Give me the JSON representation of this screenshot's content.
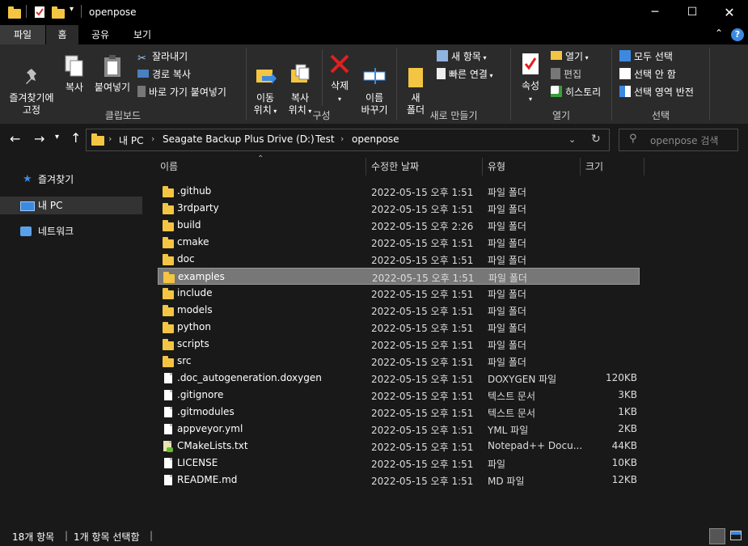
{
  "window": {
    "title": "openpose",
    "minimize_icon": "minimize-icon",
    "maximize_icon": "maximize-icon",
    "close_icon": "close-icon"
  },
  "ribbon_tabs": [
    "파일",
    "홈",
    "공유",
    "보기"
  ],
  "ribbon": {
    "clipboard": {
      "group_label": "클립보드",
      "pin": "즐겨찾기에\n고정",
      "copy": "복사",
      "paste": "붙여넣기",
      "cut": "잘라내기",
      "copy_path": "경로 복사",
      "paste_shortcut": "바로 가기 붙여넣기"
    },
    "organize": {
      "group_label": "구성",
      "move_to": "이동\n위치",
      "copy_to": "복사\n위치",
      "delete": "삭제",
      "rename": "이름\n바꾸기"
    },
    "new": {
      "group_label": "새로 만들기",
      "new_folder": "새\n폴더",
      "new_item": "새 항목",
      "easy_access": "빠른 연결"
    },
    "open": {
      "group_label": "열기",
      "properties": "속성",
      "open": "열기",
      "edit": "편집",
      "history": "히스토리"
    },
    "select": {
      "group_label": "선택",
      "select_all": "모두 선택",
      "select_none": "선택 안 함",
      "invert": "선택 영역 반전"
    }
  },
  "address": {
    "crumbs": [
      "내 PC",
      "Seagate Backup Plus Drive (D:)",
      "Test",
      "openpose"
    ],
    "search_placeholder": "openpose 검색"
  },
  "nav_pane": {
    "items": [
      {
        "label": "즐겨찾기",
        "icon": "star-icon"
      },
      {
        "label": "내 PC",
        "icon": "computer-icon"
      },
      {
        "label": "네트워크",
        "icon": "network-icon"
      }
    ]
  },
  "file_list": {
    "columns": [
      "이름",
      "수정한 날짜",
      "유형",
      "크기"
    ],
    "rows": [
      {
        "name": ".github",
        "date": "2022-05-15 오후 1:51",
        "type": "파일 폴더",
        "size": "",
        "kind": "folder"
      },
      {
        "name": "3rdparty",
        "date": "2022-05-15 오후 1:51",
        "type": "파일 폴더",
        "size": "",
        "kind": "folder"
      },
      {
        "name": "build",
        "date": "2022-05-15 오후 2:26",
        "type": "파일 폴더",
        "size": "",
        "kind": "folder"
      },
      {
        "name": "cmake",
        "date": "2022-05-15 오후 1:51",
        "type": "파일 폴더",
        "size": "",
        "kind": "folder"
      },
      {
        "name": "doc",
        "date": "2022-05-15 오후 1:51",
        "type": "파일 폴더",
        "size": "",
        "kind": "folder"
      },
      {
        "name": "examples",
        "date": "2022-05-15 오후 1:51",
        "type": "파일 폴더",
        "size": "",
        "kind": "folder",
        "selected": true
      },
      {
        "name": "include",
        "date": "2022-05-15 오후 1:51",
        "type": "파일 폴더",
        "size": "",
        "kind": "folder"
      },
      {
        "name": "models",
        "date": "2022-05-15 오후 1:51",
        "type": "파일 폴더",
        "size": "",
        "kind": "folder"
      },
      {
        "name": "python",
        "date": "2022-05-15 오후 1:51",
        "type": "파일 폴더",
        "size": "",
        "kind": "folder"
      },
      {
        "name": "scripts",
        "date": "2022-05-15 오후 1:51",
        "type": "파일 폴더",
        "size": "",
        "kind": "folder"
      },
      {
        "name": "src",
        "date": "2022-05-15 오후 1:51",
        "type": "파일 폴더",
        "size": "",
        "kind": "folder"
      },
      {
        "name": ".doc_autogeneration.doxygen",
        "date": "2022-05-15 오후 1:51",
        "type": "DOXYGEN 파일",
        "size": "120KB",
        "kind": "file"
      },
      {
        "name": ".gitignore",
        "date": "2022-05-15 오후 1:51",
        "type": "텍스트 문서",
        "size": "3KB",
        "kind": "file"
      },
      {
        "name": ".gitmodules",
        "date": "2022-05-15 오후 1:51",
        "type": "텍스트 문서",
        "size": "1KB",
        "kind": "file"
      },
      {
        "name": "appveyor.yml",
        "date": "2022-05-15 오후 1:51",
        "type": "YML 파일",
        "size": "2KB",
        "kind": "file"
      },
      {
        "name": "CMakeLists.txt",
        "date": "2022-05-15 오후 1:51",
        "type": "Notepad++ Docu...",
        "size": "44KB",
        "kind": "notepad"
      },
      {
        "name": "LICENSE",
        "date": "2022-05-15 오후 1:51",
        "type": "파일",
        "size": "10KB",
        "kind": "file"
      },
      {
        "name": "README.md",
        "date": "2022-05-15 오후 1:51",
        "type": "MD 파일",
        "size": "12KB",
        "kind": "file"
      }
    ]
  },
  "status": {
    "item_count": "18개 항목",
    "selected": "1개 항목 선택함"
  },
  "colors": {
    "folder": "#f4c542",
    "accent": "#3c8ae0",
    "selection": "#777777"
  }
}
